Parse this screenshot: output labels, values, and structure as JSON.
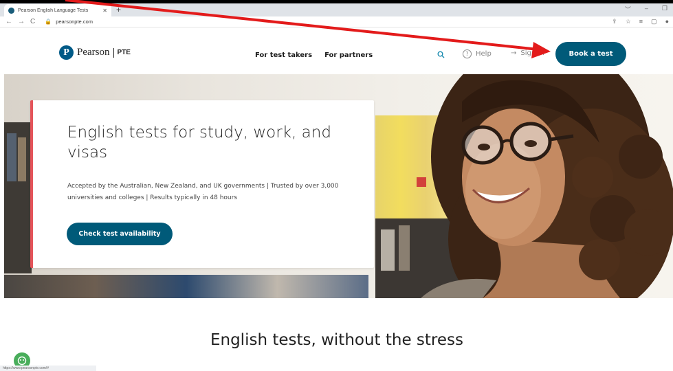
{
  "browser": {
    "tab_title": "Pearson English Language Tests",
    "tab_close": "✕",
    "new_tab": "+",
    "url": "pearsonpte.com",
    "window_controls": [
      "﹀",
      "–",
      "❐"
    ],
    "toolbar_icons": [
      "⇪",
      "☆",
      "≡",
      "▢",
      "●"
    ]
  },
  "header": {
    "logo_word": "Pearson",
    "logo_letter": "P",
    "logo_product": "PTE",
    "nav": [
      "For test takers",
      "For partners"
    ],
    "search_icon": "search-icon",
    "help_label": "Help",
    "help_icon": "?",
    "signin_label": "Sign In",
    "signin_arrow": "→",
    "book_label": "Book a test"
  },
  "hero": {
    "title": "English tests for study, work, and visas",
    "description": "Accepted by the Australian, New Zealand, and UK governments | Trusted by over 3,000 universities and colleges | Results typically in 48 hours",
    "cta_label": "Check test availability"
  },
  "section": {
    "title": "English tests, without the stress"
  },
  "chat": {
    "icon": "chat-icon"
  },
  "status_bar": "https://www.pearsonpte.com/#",
  "colors": {
    "brand": "#005a79",
    "accent": "#e4545a",
    "annotation": "#e31b1b"
  }
}
